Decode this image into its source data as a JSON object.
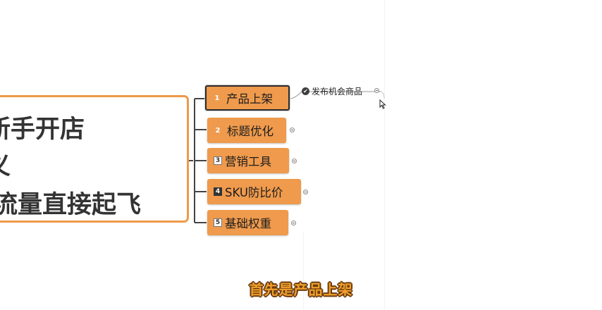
{
  "central_topic": {
    "lines": [
      "新手开店",
      "义",
      "流量直接起飞"
    ]
  },
  "branches": [
    {
      "number": "1",
      "label": "产品上架",
      "selected": true
    },
    {
      "number": "2",
      "label": "标题优化"
    },
    {
      "number": "3",
      "label": "营销工具"
    },
    {
      "number": "4",
      "label": "SKU防比价"
    },
    {
      "number": "5",
      "label": "基础权重"
    }
  ],
  "sub_topic": {
    "icon": "check-circle-icon",
    "label": "发布机会商品"
  },
  "caption": "首先是产品上架",
  "colors": {
    "node_fill": "#ef9a4c",
    "central_border": "#ee9a4a",
    "caption_fill": "#f0a02a",
    "caption_outline": "#6a3a10"
  }
}
